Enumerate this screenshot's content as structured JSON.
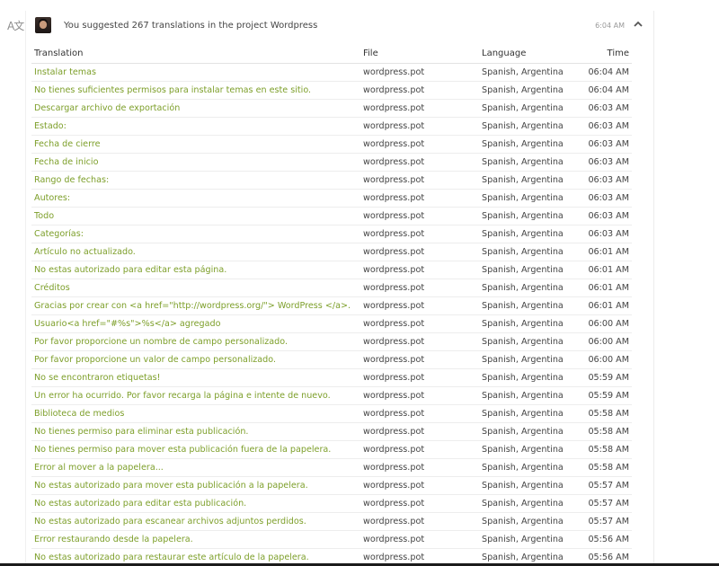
{
  "header": {
    "text_prefix": "You suggested 267 translations in the project ",
    "project": "Wordpress",
    "time": "6:04 AM"
  },
  "icons": {
    "translate": "translate-icon",
    "collapse": "chevron-up-icon"
  },
  "colors": {
    "translation_link": "#7d9f2a",
    "text": "#444444"
  },
  "table": {
    "headers": {
      "translation": "Translation",
      "file": "File",
      "language": "Language",
      "time": "Time"
    },
    "rows": [
      {
        "translation": "Instalar temas",
        "file": "wordpress.pot",
        "language": "Spanish, Argentina",
        "time": "06:04 AM"
      },
      {
        "translation": "No tienes suficientes permisos para instalar temas en este sitio.",
        "file": "wordpress.pot",
        "language": "Spanish, Argentina",
        "time": "06:04 AM"
      },
      {
        "translation": "Descargar archivo de exportación",
        "file": "wordpress.pot",
        "language": "Spanish, Argentina",
        "time": "06:03 AM"
      },
      {
        "translation": "Estado:",
        "file": "wordpress.pot",
        "language": "Spanish, Argentina",
        "time": "06:03 AM"
      },
      {
        "translation": "Fecha de cierre",
        "file": "wordpress.pot",
        "language": "Spanish, Argentina",
        "time": "06:03 AM"
      },
      {
        "translation": "Fecha de inicio",
        "file": "wordpress.pot",
        "language": "Spanish, Argentina",
        "time": "06:03 AM"
      },
      {
        "translation": "Rango de fechas:",
        "file": "wordpress.pot",
        "language": "Spanish, Argentina",
        "time": "06:03 AM"
      },
      {
        "translation": "Autores:",
        "file": "wordpress.pot",
        "language": "Spanish, Argentina",
        "time": "06:03 AM"
      },
      {
        "translation": "Todo",
        "file": "wordpress.pot",
        "language": "Spanish, Argentina",
        "time": "06:03 AM"
      },
      {
        "translation": "Categorías:",
        "file": "wordpress.pot",
        "language": "Spanish, Argentina",
        "time": "06:03 AM"
      },
      {
        "translation": "Artículo no actualizado.",
        "file": "wordpress.pot",
        "language": "Spanish, Argentina",
        "time": "06:01 AM"
      },
      {
        "translation": "No estas autorizado para editar esta página.",
        "file": "wordpress.pot",
        "language": "Spanish, Argentina",
        "time": "06:01 AM"
      },
      {
        "translation": "Créditos",
        "file": "wordpress.pot",
        "language": "Spanish, Argentina",
        "time": "06:01 AM"
      },
      {
        "translation": "Gracias por crear con <a href=\"http://wordpress.org/\"> WordPress </a>.",
        "file": "wordpress.pot",
        "language": "Spanish, Argentina",
        "time": "06:01 AM"
      },
      {
        "translation": "Usuario<a href=\"#%s\">%s</a> agregado",
        "file": "wordpress.pot",
        "language": "Spanish, Argentina",
        "time": "06:00 AM"
      },
      {
        "translation": "Por favor proporcione un nombre de campo personalizado.",
        "file": "wordpress.pot",
        "language": "Spanish, Argentina",
        "time": "06:00 AM"
      },
      {
        "translation": "Por favor proporcione un valor de campo personalizado.",
        "file": "wordpress.pot",
        "language": "Spanish, Argentina",
        "time": "06:00 AM"
      },
      {
        "translation": "No se encontraron etiquetas!",
        "file": "wordpress.pot",
        "language": "Spanish, Argentina",
        "time": "05:59 AM"
      },
      {
        "translation": "Un error ha ocurrido. Por favor recarga la página e intente de nuevo.",
        "file": "wordpress.pot",
        "language": "Spanish, Argentina",
        "time": "05:59 AM"
      },
      {
        "translation": "Biblioteca de medios",
        "file": "wordpress.pot",
        "language": "Spanish, Argentina",
        "time": "05:58 AM"
      },
      {
        "translation": "No tienes permiso para eliminar esta publicación.",
        "file": "wordpress.pot",
        "language": "Spanish, Argentina",
        "time": "05:58 AM"
      },
      {
        "translation": "No tienes permiso para mover esta publicación fuera de la papelera.",
        "file": "wordpress.pot",
        "language": "Spanish, Argentina",
        "time": "05:58 AM"
      },
      {
        "translation": "Error al mover a la papelera...",
        "file": "wordpress.pot",
        "language": "Spanish, Argentina",
        "time": "05:58 AM"
      },
      {
        "translation": "No estas autorizado para mover esta publicación a la papelera.",
        "file": "wordpress.pot",
        "language": "Spanish, Argentina",
        "time": "05:57 AM"
      },
      {
        "translation": "No estas autorizado para editar esta publicación.",
        "file": "wordpress.pot",
        "language": "Spanish, Argentina",
        "time": "05:57 AM"
      },
      {
        "translation": "No estas autorizado para escanear archivos adjuntos perdidos.",
        "file": "wordpress.pot",
        "language": "Spanish, Argentina",
        "time": "05:57 AM"
      },
      {
        "translation": "Error restaurando desde la papelera.",
        "file": "wordpress.pot",
        "language": "Spanish, Argentina",
        "time": "05:56 AM"
      },
      {
        "translation": "No estas autorizado para restaurar este artículo de la papelera.",
        "file": "wordpress.pot",
        "language": "Spanish, Argentina",
        "time": "05:56 AM"
      }
    ]
  }
}
